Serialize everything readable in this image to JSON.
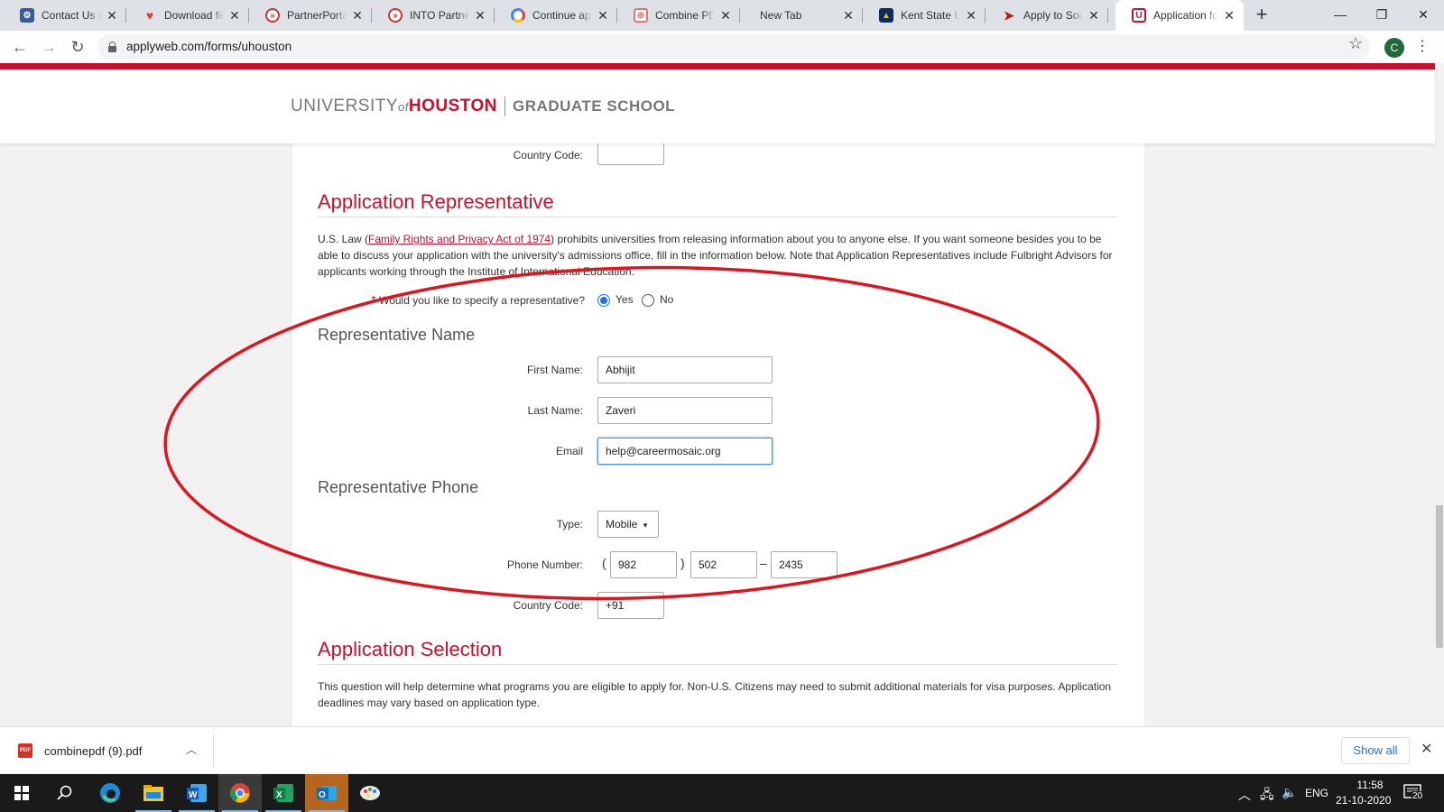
{
  "browser": {
    "tabs": [
      {
        "title": "Contact Us | A",
        "icon": "gear-badge-icon",
        "color": "#3b5998"
      },
      {
        "title": "Download file",
        "icon": "heart-icon",
        "color": "#e53935"
      },
      {
        "title": "PartnerPortal",
        "icon": "partner-portal-icon",
        "color": "#d32f2f"
      },
      {
        "title": "INTO PartnerP",
        "icon": "partner-portal-icon",
        "color": "#d32f2f"
      },
      {
        "title": "Continue app",
        "icon": "google-icon",
        "color": "#4285f4"
      },
      {
        "title": "Combine PDF",
        "icon": "combine-pdf-icon",
        "color": "#e57373"
      },
      {
        "title": "New Tab",
        "icon": "",
        "color": ""
      },
      {
        "title": "Kent State Un",
        "icon": "kent-state-icon",
        "color": "#0d2b5b"
      },
      {
        "title": "Apply to Sout",
        "icon": "southern-logo-icon",
        "color": "#b71c1c"
      },
      {
        "title": "Application fo",
        "icon": "uh-seal-icon",
        "color": "#c8102e"
      }
    ],
    "new_tab_symbol": "+",
    "window_controls": {
      "minimize": "—",
      "restore": "❐",
      "close": "✕"
    },
    "url": "applyweb.com/forms/uhouston",
    "profile_initial": "C"
  },
  "header": {
    "logo_university": "UNIVERSITY",
    "logo_of": "of",
    "logo_houston": "HOUSTON",
    "logo_school": "GRADUATE SCHOOL"
  },
  "form": {
    "top_country_code_label": "Country Code:",
    "top_country_code_value": "",
    "rep_section_title": "Application Representative",
    "rep_paragraph_prefix": "U.S. Law (",
    "rep_paragraph_link": "Family Rights and Privacy Act of 1974",
    "rep_paragraph_suffix": ") prohibits universities from releasing information about you to anyone else. If you want someone besides you to be able to discuss your application with the university's admissions office, fill in the information below. Note that Application Representatives include Fulbright Advisors for applicants working through the Institute of International Education.",
    "specify_required_mark": "*",
    "specify_question": "Would you like to specify a representative?",
    "specify_yes": "Yes",
    "specify_no": "No",
    "specify_selected": "Yes",
    "name_subtitle": "Representative Name",
    "first_name_label": "First Name:",
    "first_name_value": "Abhijit",
    "last_name_label": "Last Name:",
    "last_name_value": "Zaveri",
    "email_label": "Email",
    "email_value": "help@careermosaic.org",
    "phone_subtitle": "Representative Phone",
    "type_label": "Type:",
    "type_value": "Mobile",
    "type_caret": "▾",
    "phone_label": "Phone Number:",
    "phone_open_paren": "(",
    "phone_close_paren": ")",
    "phone_dash": "–",
    "phone_area": "982",
    "phone_prefix": "502",
    "phone_line": "2435",
    "country_code_label": "Country Code:",
    "country_code_value": "+91",
    "selection_section_title": "Application Selection",
    "selection_paragraph": "This question will help determine what programs you are eligible to apply for. Non-U.S. Citizens may need to submit additional materials for visa purposes. Application deadlines may vary based on application type."
  },
  "annotation_color": "#e0141e",
  "downloads": {
    "file_name": "combinepdf (9).pdf",
    "file_badge": "PDF",
    "show_all_label": "Show all"
  },
  "taskbar": {
    "language": "ENG",
    "time": "11:58",
    "date": "21-10-2020",
    "notification_count": "20",
    "apps": [
      "windows-start-icon",
      "search-icon",
      "edge-icon",
      "file-explorer-icon",
      "word-icon",
      "chrome-icon",
      "excel-icon",
      "outlook-icon",
      "paint-icon"
    ]
  }
}
